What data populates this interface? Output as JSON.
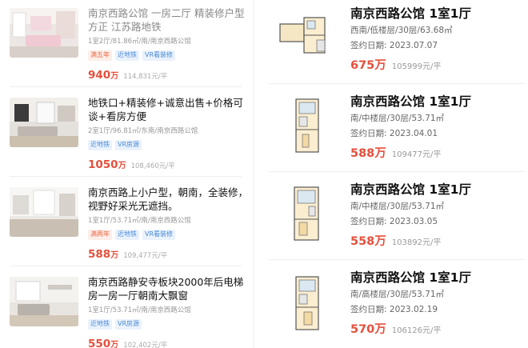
{
  "listings": [
    {
      "title": "南京西路公馆 一房二厅 精装修户型方正 江苏路地铁",
      "title_style": "gray",
      "meta": "1室2厅/81.86㎡/南/南京西路公馆",
      "tags": [
        {
          "text": "满五年",
          "color": "red"
        },
        {
          "text": "近地铁",
          "color": "blue"
        },
        {
          "text": "VR看装修",
          "color": "blue"
        }
      ],
      "price": "940",
      "price_unit": "万",
      "unit_price": "114,831元/平"
    },
    {
      "title": "地铁口+精装修+诚意出售+价格可谈+看房方便",
      "title_style": "dark",
      "meta": "2室1厅/96.81㎡/东南/南京西路公馆",
      "tags": [
        {
          "text": "近地铁",
          "color": "blue"
        },
        {
          "text": "VR房源",
          "color": "blue"
        }
      ],
      "price": "1050",
      "price_unit": "万",
      "unit_price": "108,460元/平"
    },
    {
      "title": "南京西路上小户型，朝南，全装修，视野好采光无遮挡。",
      "title_style": "dark",
      "meta": "1室1厅/53.71㎡/南/南京西路公馆",
      "tags": [
        {
          "text": "满两年",
          "color": "red"
        },
        {
          "text": "近地铁",
          "color": "blue"
        },
        {
          "text": "VR看装修",
          "color": "blue"
        }
      ],
      "price": "588",
      "price_unit": "万",
      "unit_price": "109,477元/平"
    },
    {
      "title": "南京西路静安寺板块2000年后电梯房一房一厅朝南大飘窗",
      "title_style": "dark",
      "meta": "1室1厅/53.71㎡/南/南京西路公馆",
      "tags": [
        {
          "text": "近地铁",
          "color": "blue"
        },
        {
          "text": "VR房源",
          "color": "blue"
        }
      ],
      "price": "550",
      "price_unit": "万",
      "unit_price": "102,402元/平"
    }
  ],
  "sold": [
    {
      "title": "南京西路公馆 1室1厅",
      "detail": "西南/低楼层/30层/63.68㎡",
      "date_label": "签约日期:",
      "date": "2023.07.07",
      "price": "675万",
      "unit_price": "105999元/平"
    },
    {
      "title": "南京西路公馆 1室1厅",
      "detail": "南/中楼层/30层/53.71㎡",
      "date_label": "签约日期:",
      "date": "2023.04.01",
      "price": "588万",
      "unit_price": "109477元/平"
    },
    {
      "title": "南京西路公馆 1室1厅",
      "detail": "南/中楼层/30层/53.71㎡",
      "date_label": "签约日期:",
      "date": "2023.03.05",
      "price": "558万",
      "unit_price": "103892元/平"
    },
    {
      "title": "南京西路公馆 1室1厅",
      "detail": "南/高楼层/30层/53.71㎡",
      "date_label": "签约日期:",
      "date": "2023.02.19",
      "price": "570万",
      "unit_price": "106126元/平"
    }
  ],
  "colors": {
    "price": "#e4503c",
    "tag_red": "#e86b4a",
    "tag_blue": "#4b8bd6"
  }
}
